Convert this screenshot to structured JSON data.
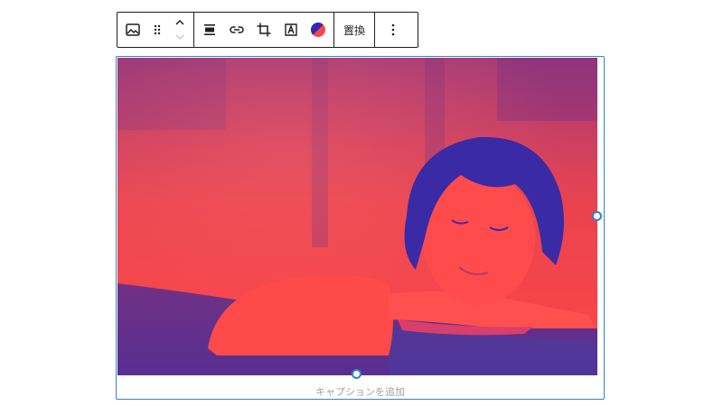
{
  "toolbar": {
    "replace_label": "置換"
  },
  "caption": {
    "placeholder": "キャプションを追加"
  },
  "duotone": {
    "shadow": "#3f2aa0",
    "highlight": "#ff4646"
  },
  "icons": [
    "image-icon",
    "drag-handle-icon",
    "chevron-up-icon",
    "chevron-down-icon",
    "align-icon",
    "link-icon",
    "crop-icon",
    "text-overlay-icon",
    "duotone-icon",
    "more-options-icon"
  ]
}
